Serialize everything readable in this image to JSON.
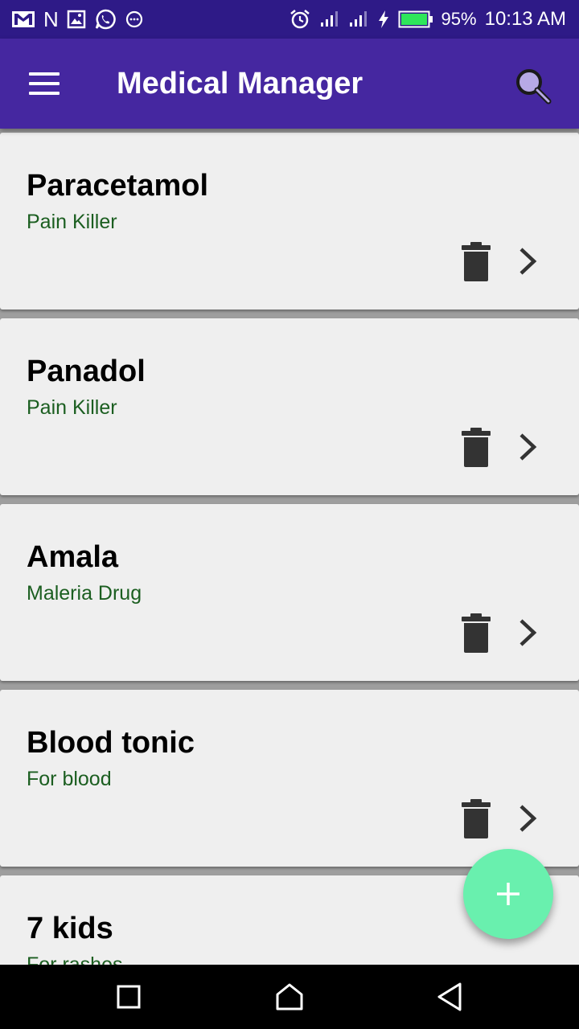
{
  "status_bar": {
    "battery": "95%",
    "time": "10:13 AM",
    "left_icons": [
      "gmail-icon",
      "n-icon",
      "image-icon",
      "whatsapp-icon",
      "chat-bubble-icon"
    ],
    "right_icons": [
      "alarm-icon",
      "signal-icon",
      "signal-icon",
      "charging-icon",
      "battery-icon"
    ],
    "battery_level": 0.95
  },
  "app_bar": {
    "title": "Medical Manager",
    "background": "#4527a0"
  },
  "medicines": [
    {
      "name": "Paracetamol",
      "category": "Pain Killer"
    },
    {
      "name": "Panadol",
      "category": "Pain Killer"
    },
    {
      "name": "Amala",
      "category": "Maleria Drug"
    },
    {
      "name": "Blood tonic",
      "category": "For blood"
    },
    {
      "name": "7 kids",
      "category": "For rashes"
    }
  ],
  "fab": {
    "icon": "plus-icon",
    "color": "#69f0ae"
  },
  "colors": {
    "status_bar": "#2e1a87",
    "category_text": "#1b5e20",
    "card": "#efefef"
  }
}
